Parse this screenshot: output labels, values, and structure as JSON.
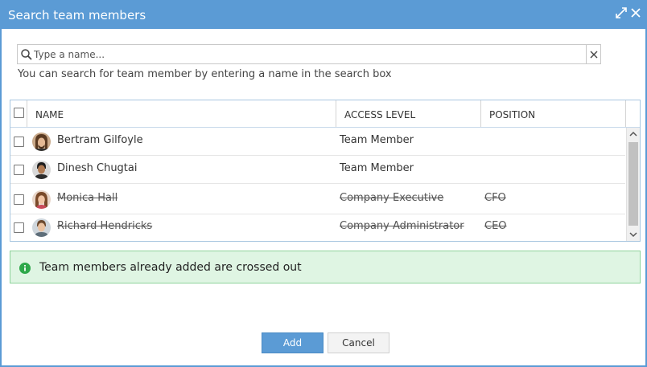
{
  "dialog": {
    "title": "Search team members",
    "maximize_icon": "expand-icon",
    "close_icon": "close-icon"
  },
  "search": {
    "placeholder": "Type a name...",
    "value": "",
    "helper": "You can search for team member by entering a name in the search box"
  },
  "grid": {
    "columns": [
      "NAME",
      "ACCESS LEVEL",
      "POSITION"
    ],
    "rows": [
      {
        "name": "Bertram Gilfoyle",
        "access": "Team Member",
        "position": "",
        "crossed": false
      },
      {
        "name": "Dinesh Chugtai",
        "access": "Team Member",
        "position": "",
        "crossed": false
      },
      {
        "name": "Monica Hall",
        "access": "Company Executive",
        "position": "CFO",
        "crossed": true
      },
      {
        "name": "Richard Hendricks",
        "access": "Company Administrator",
        "position": "CEO",
        "crossed": true
      }
    ]
  },
  "info": {
    "text": "Team members already added are crossed out",
    "color": "#2ea84a"
  },
  "buttons": {
    "add": "Add",
    "cancel": "Cancel"
  },
  "colors": {
    "accent": "#5b9bd5",
    "info_bg": "#dff5e3"
  }
}
